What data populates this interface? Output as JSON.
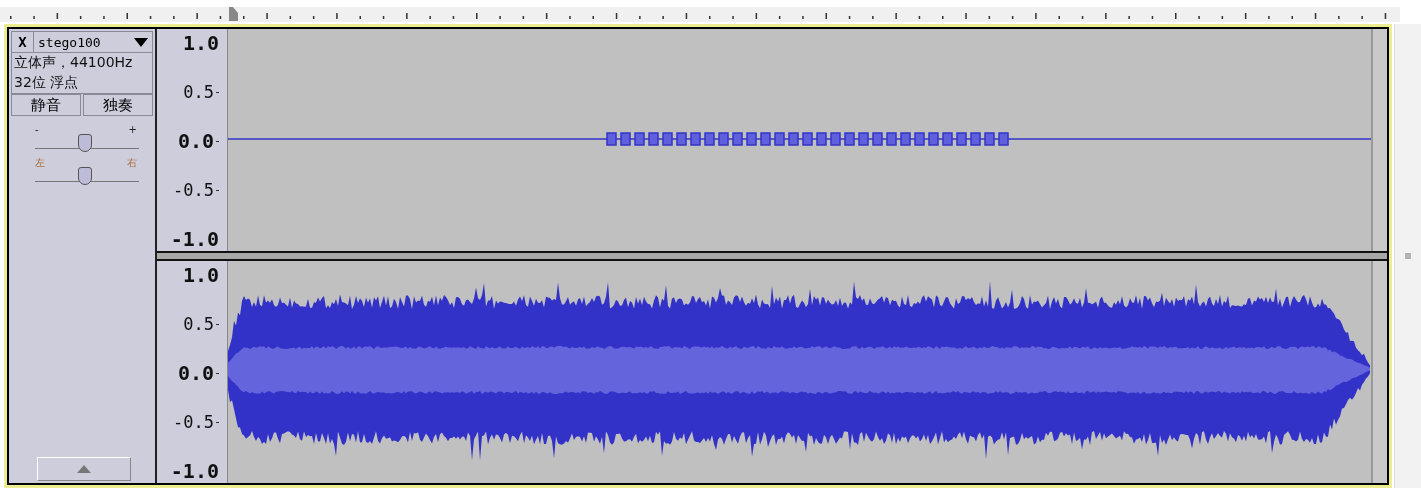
{
  "track": {
    "close_label": "X",
    "name": "stego100",
    "info": [
      "立体声，44100Hz",
      "32位 浮点"
    ],
    "buttons": [
      "静音",
      "独奏"
    ],
    "gain": {
      "min_label": "-",
      "max_label": "+",
      "level": 0.48
    },
    "pan": {
      "min_label": "左",
      "max_label": "右",
      "level": 0.48
    }
  },
  "channels": [
    {
      "kind": "tones",
      "scale": [
        "1.0",
        "0.5",
        "0.0",
        "-0.5",
        "-1.0"
      ]
    },
    {
      "kind": "music",
      "scale": [
        "1.0",
        "0.5",
        "0.0",
        "-0.5",
        "-1.0"
      ]
    }
  ]
}
